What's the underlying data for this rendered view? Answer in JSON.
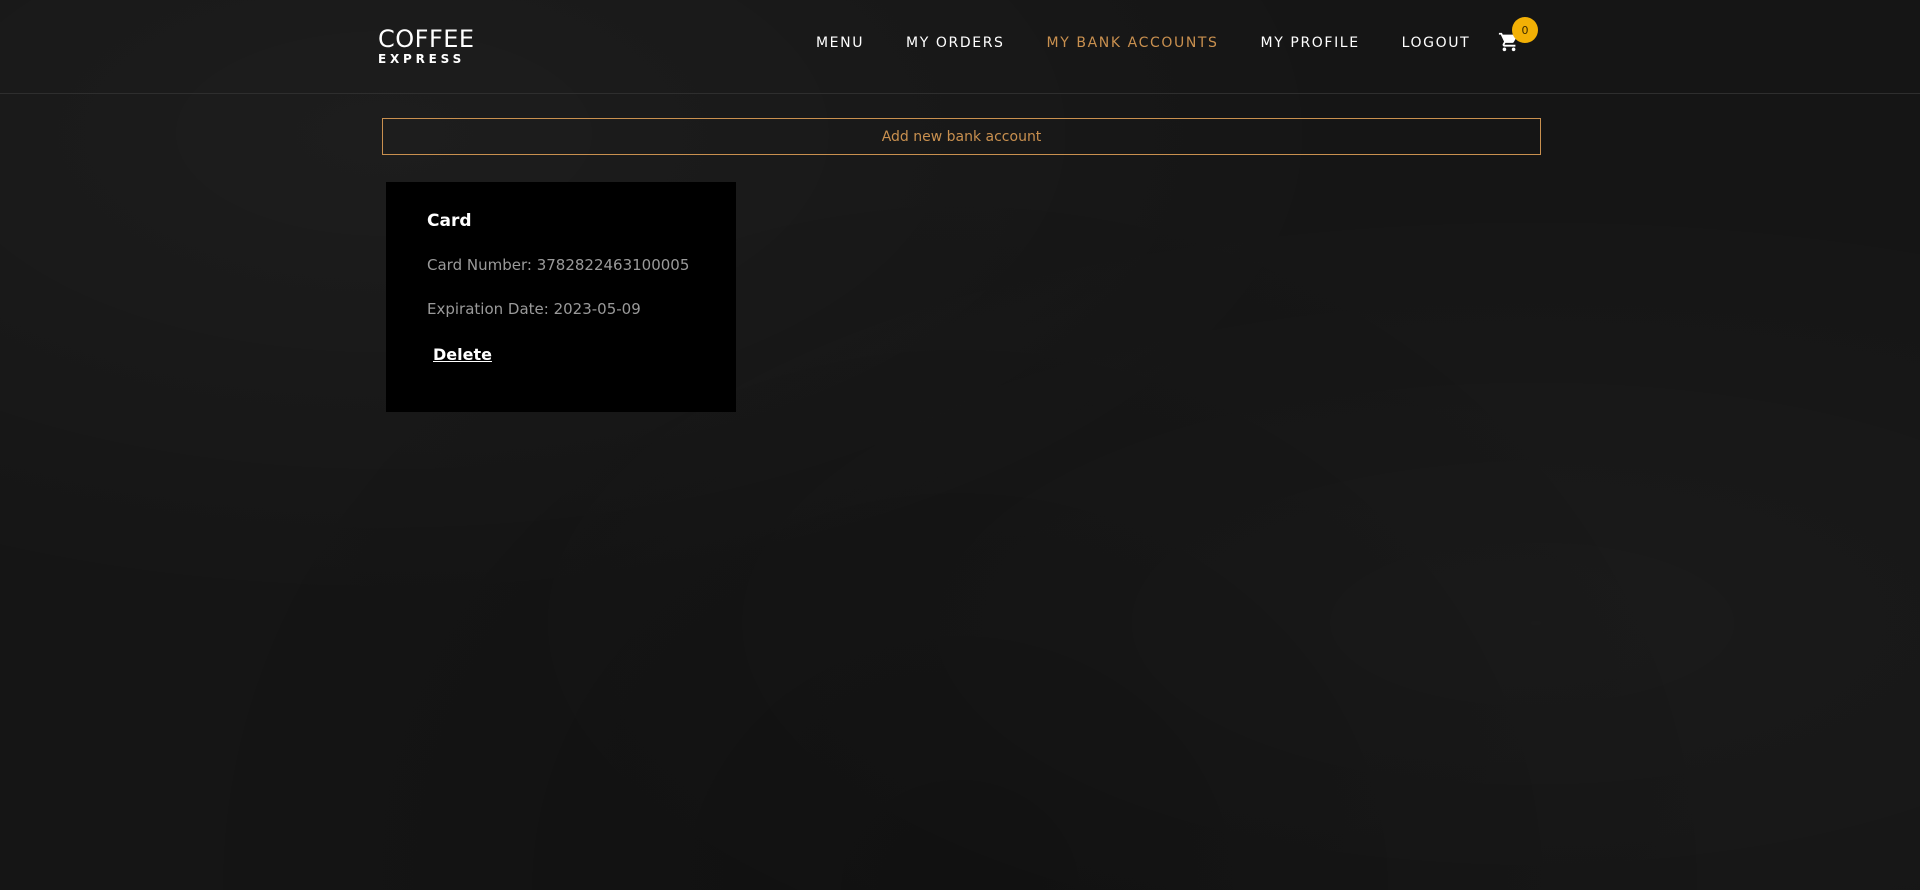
{
  "brand": {
    "name": "COFFEE",
    "tagline": "EXPRESS"
  },
  "nav": {
    "items": [
      {
        "label": "MENU",
        "active": false
      },
      {
        "label": "MY ORDERS",
        "active": false
      },
      {
        "label": "MY BANK ACCOUNTS",
        "active": true
      },
      {
        "label": "MY PROFILE",
        "active": false
      },
      {
        "label": "LOGOUT",
        "active": false
      }
    ],
    "cart_icon": "shopping-cart-icon",
    "cart_count": "0"
  },
  "main": {
    "add_account_label": "Add new bank account",
    "cards": [
      {
        "title": "Card",
        "card_number_label": "Card Number:",
        "card_number": "3782822463100005",
        "expiration_label": "Expiration Date:",
        "expiration_date": "2023-05-09",
        "delete_label": "Delete"
      }
    ]
  },
  "colors": {
    "accent": "#c9904f",
    "badge": "#f2b005",
    "background": "#151515",
    "card_background": "#000000"
  }
}
